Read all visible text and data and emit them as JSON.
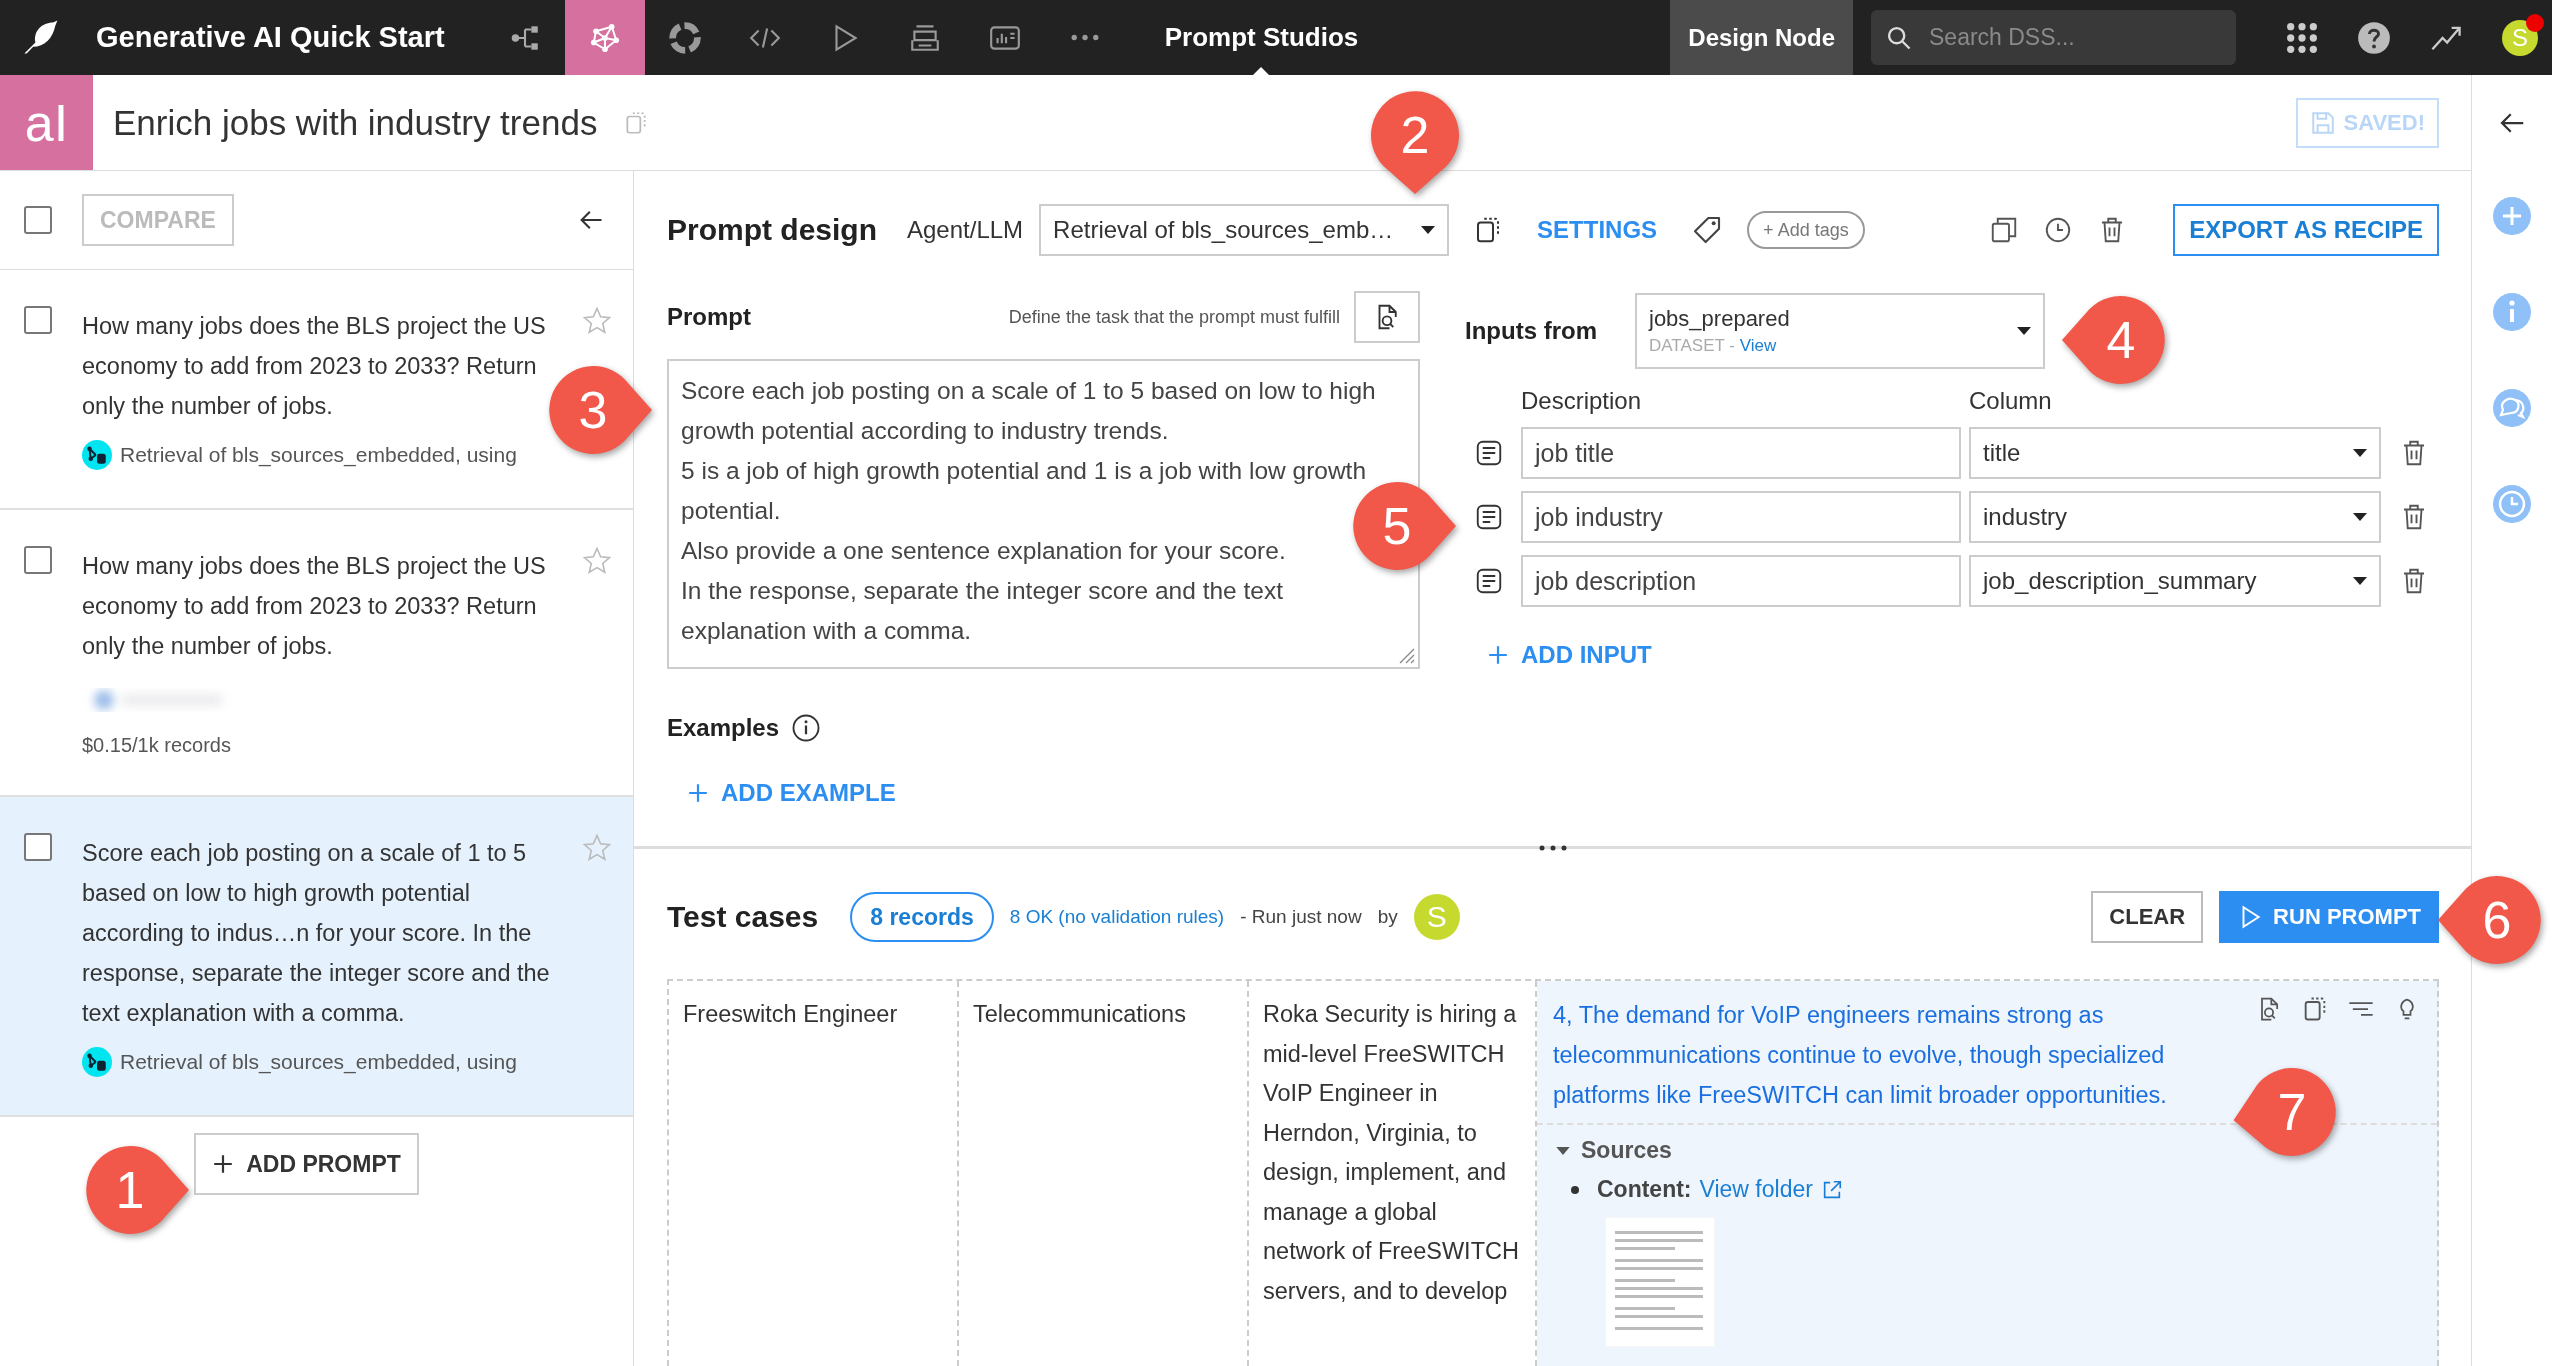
{
  "app": {
    "project": "Generative AI Quick Start",
    "section": "Prompt Studios",
    "node": "Design Node",
    "search_placeholder": "Search DSS...",
    "avatar": "S",
    "has_notification": true,
    "nav": [
      {
        "kind": "flow",
        "selected": false
      },
      {
        "kind": "lab",
        "selected": true
      },
      {
        "kind": "donut",
        "selected": false
      },
      {
        "kind": "code",
        "selected": false
      },
      {
        "kind": "run",
        "selected": false
      },
      {
        "kind": "deploy",
        "selected": false
      },
      {
        "kind": "dashboard",
        "selected": false
      },
      {
        "kind": "more",
        "selected": false
      }
    ]
  },
  "studio": {
    "logo": "aI",
    "title": "Enrich jobs with industry trends",
    "save_label": "SAVED!"
  },
  "sidebar": {
    "select_all_checked": false,
    "compare": "COMPARE",
    "add": "ADD PROMPT",
    "items": [
      {
        "text": "How many jobs does the BLS project the US economy to add from 2023 to 2033? Return only the number of jobs.",
        "model": "Retrieval of bls_sources_embedded, using",
        "selected": false,
        "checked": false,
        "starred": false
      },
      {
        "text": "How many jobs does the BLS project the US economy to add from 2023 to 2033? Return only the number of jobs.",
        "redacted": true,
        "cost": "$0.15/1k records",
        "selected": false,
        "checked": false,
        "starred": false
      },
      {
        "text": "Score each job posting on a scale of 1 to 5 based on low to high growth potential according to indus…n for your score. In the response, separate the integer score and the text explanation with a comma.",
        "model": "Retrieval of bls_sources_embedded, using",
        "selected": true,
        "checked": false,
        "starred": false
      }
    ]
  },
  "design": {
    "heading": "Prompt design",
    "agent_label": "Agent/LLM",
    "agent_value": "Retrieval of bls_sources_emb…",
    "settings": "SETTINGS",
    "add_tags": "+ Add tags",
    "export": "EXPORT AS RECIPE",
    "prompt_label": "Prompt",
    "prompt_hint": "Define the task that the prompt must fulfill",
    "prompt": [
      "Score each job posting on a scale of 1 to 5 based on low to high growth potential according to industry trends.",
      "5 is a job of high growth potential and 1 is a job with low growth potential.",
      "Also provide a one sentence explanation for your score.",
      "In the response, separate the integer score and the text explanation with a comma."
    ],
    "examples_label": "Examples",
    "add_example": "ADD EXAMPLE",
    "inputs_label": "Inputs from",
    "dataset": "jobs_prepared",
    "dataset_type": "DATASET",
    "dataset_sep": "-",
    "dataset_link": "View",
    "desc_header": "Description",
    "col_header": "Column",
    "inputs": [
      {
        "description": "job title",
        "column": "title"
      },
      {
        "description": "job industry",
        "column": "industry"
      },
      {
        "description": "job description",
        "column": "job_description_summary"
      }
    ],
    "add_input": "ADD INPUT"
  },
  "tests": {
    "heading": "Test cases",
    "records": "8 records",
    "status": "8 OK (no validation rules)",
    "run_info": "- Run just now",
    "by": "by",
    "avatar": "S",
    "clear": "CLEAR",
    "run": "RUN PROMPT",
    "cells": [
      "Freeswitch Engineer",
      "Telecommunications",
      "Roka Security is hiring a mid-level FreeSWITCH VoIP Engineer in Herndon, Virginia, to design, implement, and manage a global network of FreeSWITCH servers, and to develop"
    ],
    "response": "4, The demand for VoIP engineers remains strong as telecommunications continue to evolve, though specialized platforms like FreeSWITCH can limit broader opportunities.",
    "sources_label": "Sources",
    "sources_expanded": true,
    "content_label": "Content:",
    "content_link": "View folder"
  },
  "callouts": [
    {
      "label": "1"
    },
    {
      "label": "2"
    },
    {
      "label": "3"
    },
    {
      "label": "4"
    },
    {
      "label": "5"
    },
    {
      "label": "6"
    },
    {
      "label": "7"
    }
  ]
}
